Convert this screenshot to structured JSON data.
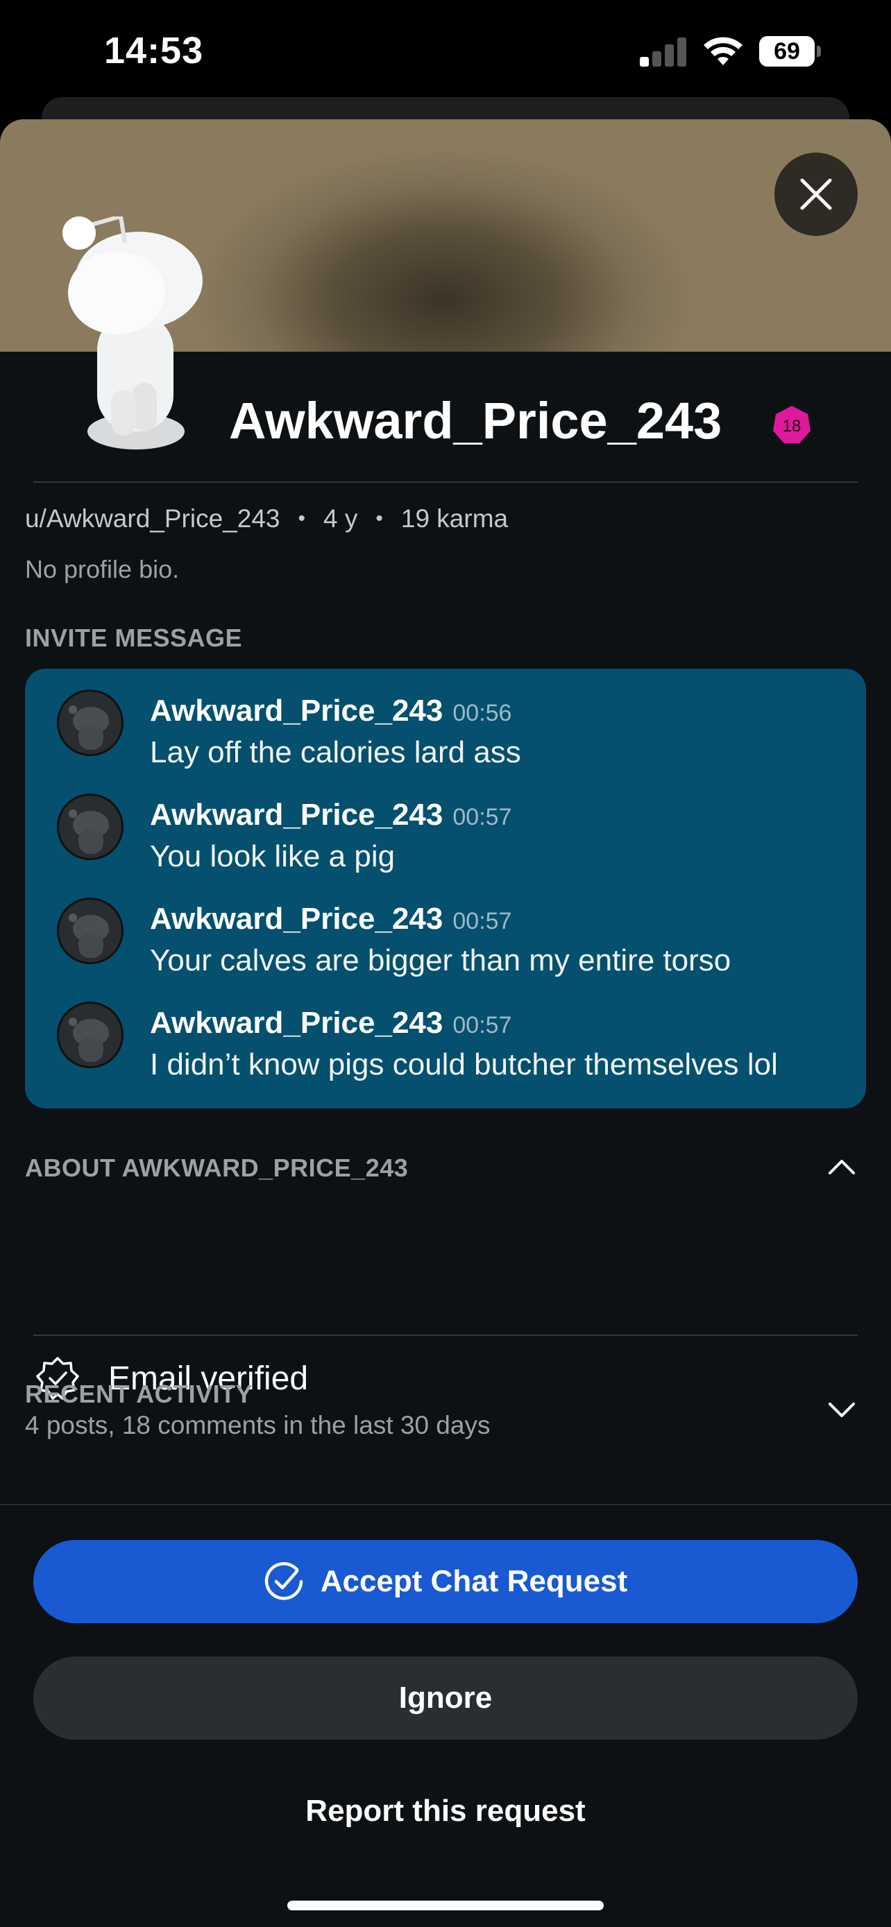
{
  "status_bar": {
    "time": "14:53",
    "battery": "69",
    "signal_bars_on": 1,
    "signal_bars_total": 4
  },
  "profile": {
    "username": "Awkward_Price_243",
    "nsfw_badge": "18",
    "handle": "u/Awkward_Price_243",
    "age": "4 y",
    "karma": "19 karma",
    "bio": "No profile bio.",
    "banner_icon": "close-icon"
  },
  "invite": {
    "title": "INVITE MESSAGE",
    "messages": [
      {
        "author": "Awkward_Price_243",
        "time": "00:56",
        "text": "Lay off the calories lard ass"
      },
      {
        "author": "Awkward_Price_243",
        "time": "00:57",
        "text": "You look like a pig"
      },
      {
        "author": "Awkward_Price_243",
        "time": "00:57",
        "text": "Your calves are bigger than my entire torso"
      },
      {
        "author": "Awkward_Price_243",
        "time": "00:57",
        "text": "I didn’t know pigs could butcher themselves lol"
      }
    ]
  },
  "about": {
    "title": "ABOUT AWKWARD_PRICE_243",
    "items": [
      {
        "icon": "verified-badge-icon",
        "label": "Email verified"
      }
    ]
  },
  "recent_activity": {
    "title": "RECENT ACTIVITY",
    "summary": "4 posts, 18 comments in the last 30 days"
  },
  "actions": {
    "accept": "Accept Chat Request",
    "ignore": "Ignore",
    "report": "Report this request"
  },
  "colors": {
    "accent": "#1959d2",
    "invite_bg": "#04506e",
    "nsfw": "#e0199c",
    "sheet_bg": "#0e1113"
  }
}
